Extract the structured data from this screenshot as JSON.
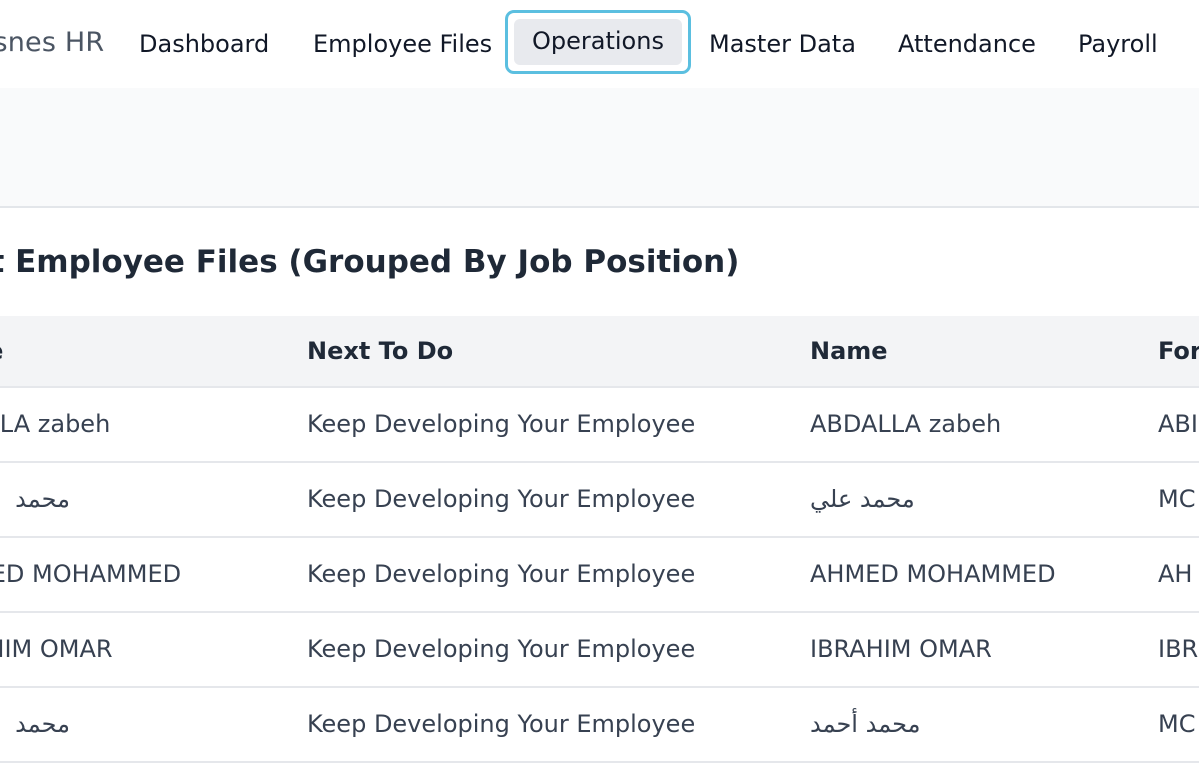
{
  "nav": {
    "brand": "Osnes HR",
    "items": [
      {
        "label": "Dashboard"
      },
      {
        "label": "Employee Files"
      },
      {
        "label": "Operations",
        "active": true
      },
      {
        "label": "Master Data"
      },
      {
        "label": "Attendance"
      },
      {
        "label": "Payroll"
      }
    ]
  },
  "section": {
    "title": "ft Employee Files (Grouped By Job Position)"
  },
  "table": {
    "columns": [
      "ne",
      "Next To Do",
      "Name",
      "For"
    ],
    "rows": [
      {
        "a": "ALLA zabeh",
        "next": "Keep Developing Your Employee",
        "name": "ABDALLA zabeh",
        "d": "ABI"
      },
      {
        "a": "محمد",
        "next": "Keep Developing Your Employee",
        "name": "محمد علي",
        "d": "MC"
      },
      {
        "a": "MED MOHAMMED",
        "next": "Keep Developing Your Employee",
        "name": "AHMED MOHAMMED",
        "d": "AH"
      },
      {
        "a": "AHIM OMAR",
        "next": "Keep Developing Your Employee",
        "name": "IBRAHIM OMAR",
        "d": "IBR"
      },
      {
        "a": "محمد",
        "next": "Keep Developing Your Employee",
        "name": "محمد أحمد",
        "d": "MC"
      }
    ]
  },
  "colors": {
    "active_ring": "#5bbfe0",
    "active_bg": "#e8eaee",
    "page_bg": "#f9fafb"
  }
}
